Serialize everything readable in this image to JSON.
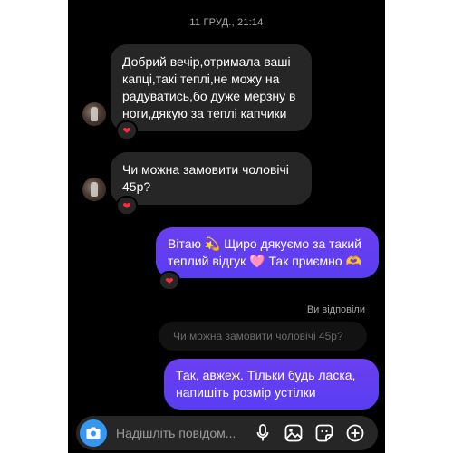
{
  "timestamp": "11 ГРУД., 21:14",
  "messages": [
    {
      "direction": "incoming",
      "text": "Добрий вечір,отримала ваші\nкапці,такі теплі,не можу на\nрадуватись,бо дуже мерзну в\nноги,дякую за теплі капчики",
      "reaction": "❤"
    },
    {
      "direction": "incoming",
      "text": "Чи можна замовити чоловічі\n45р?",
      "reaction": "❤"
    },
    {
      "direction": "outgoing",
      "text": "Вітаю 💫 Щиро дякуємо за такий\nтеплий відгук 🩷 Так приємно 🫶",
      "reaction": "❤"
    },
    {
      "direction": "outgoing",
      "replied_label": "Ви відповіли",
      "reply_preview": "Чи можна замовити чоловічі 45р?",
      "text": "Так, авжеж. Тільки будь ласка,\nнапишіть розмір устілки"
    }
  ],
  "composer": {
    "placeholder": "Надішліть повідом...",
    "value": ""
  },
  "icons": {
    "camera": "camera-icon",
    "mic": "microphone-icon",
    "gallery": "image-icon",
    "sticker": "sticker-icon",
    "add": "plus-icon"
  },
  "colors": {
    "background": "#000000",
    "incoming_bubble": "#262626",
    "outgoing_bubble": "#5a3df2",
    "camera_button": "#3797f0",
    "reaction_heart": "#ff2b3a"
  }
}
